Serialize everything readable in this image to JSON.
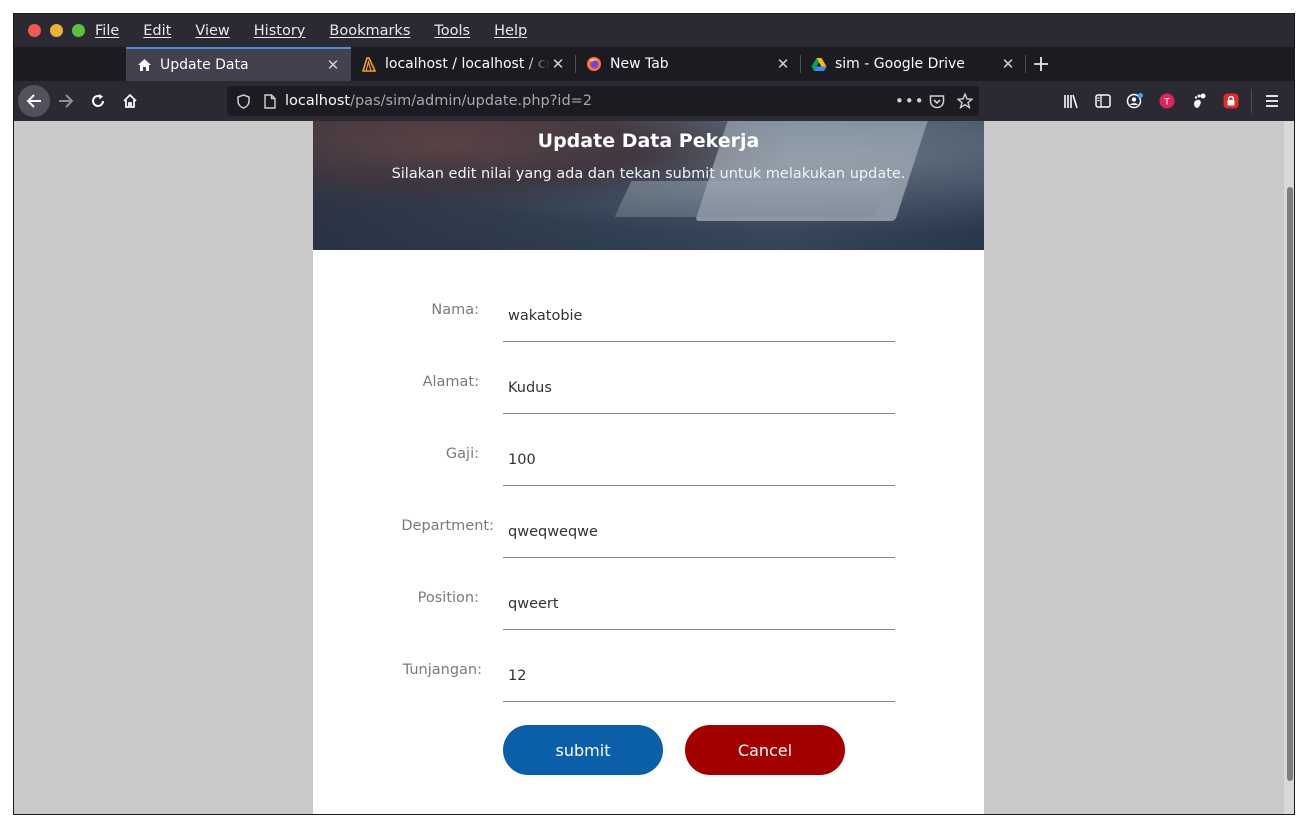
{
  "menu": [
    "File",
    "Edit",
    "View",
    "History",
    "Bookmarks",
    "Tools",
    "Help"
  ],
  "tabs": [
    {
      "title": "Update Data",
      "icon": "home-icon",
      "active": true
    },
    {
      "title": "localhost / localhost / crud",
      "icon": "phpmyadmin-icon",
      "active": false
    },
    {
      "title": "New Tab",
      "icon": "firefox-icon",
      "active": false
    },
    {
      "title": "sim - Google Drive",
      "icon": "google-drive-icon",
      "active": false
    }
  ],
  "url": {
    "host": "localhost",
    "path": "/pas/sim/admin/update.php?id=2"
  },
  "page": {
    "title": "Update Data Pekerja",
    "subtitle": "Silakan edit nilai yang ada dan tekan submit untuk melakukan update."
  },
  "form": {
    "fields": [
      {
        "label": "Nama:",
        "value": "wakatobie"
      },
      {
        "label": "Alamat:",
        "value": "Kudus"
      },
      {
        "label": "Gaji:",
        "value": "100"
      },
      {
        "label": "Department:",
        "value": "qweqweqwe"
      },
      {
        "label": "Position:",
        "value": "qweert"
      },
      {
        "label": "Tunjangan:",
        "value": "12"
      }
    ],
    "submit_label": "submit",
    "cancel_label": "Cancel"
  },
  "colors": {
    "submit": "#0b5ea8",
    "cancel": "#a30000",
    "chrome": "#2b2a33",
    "tab_accent": "#4a8fd6"
  }
}
